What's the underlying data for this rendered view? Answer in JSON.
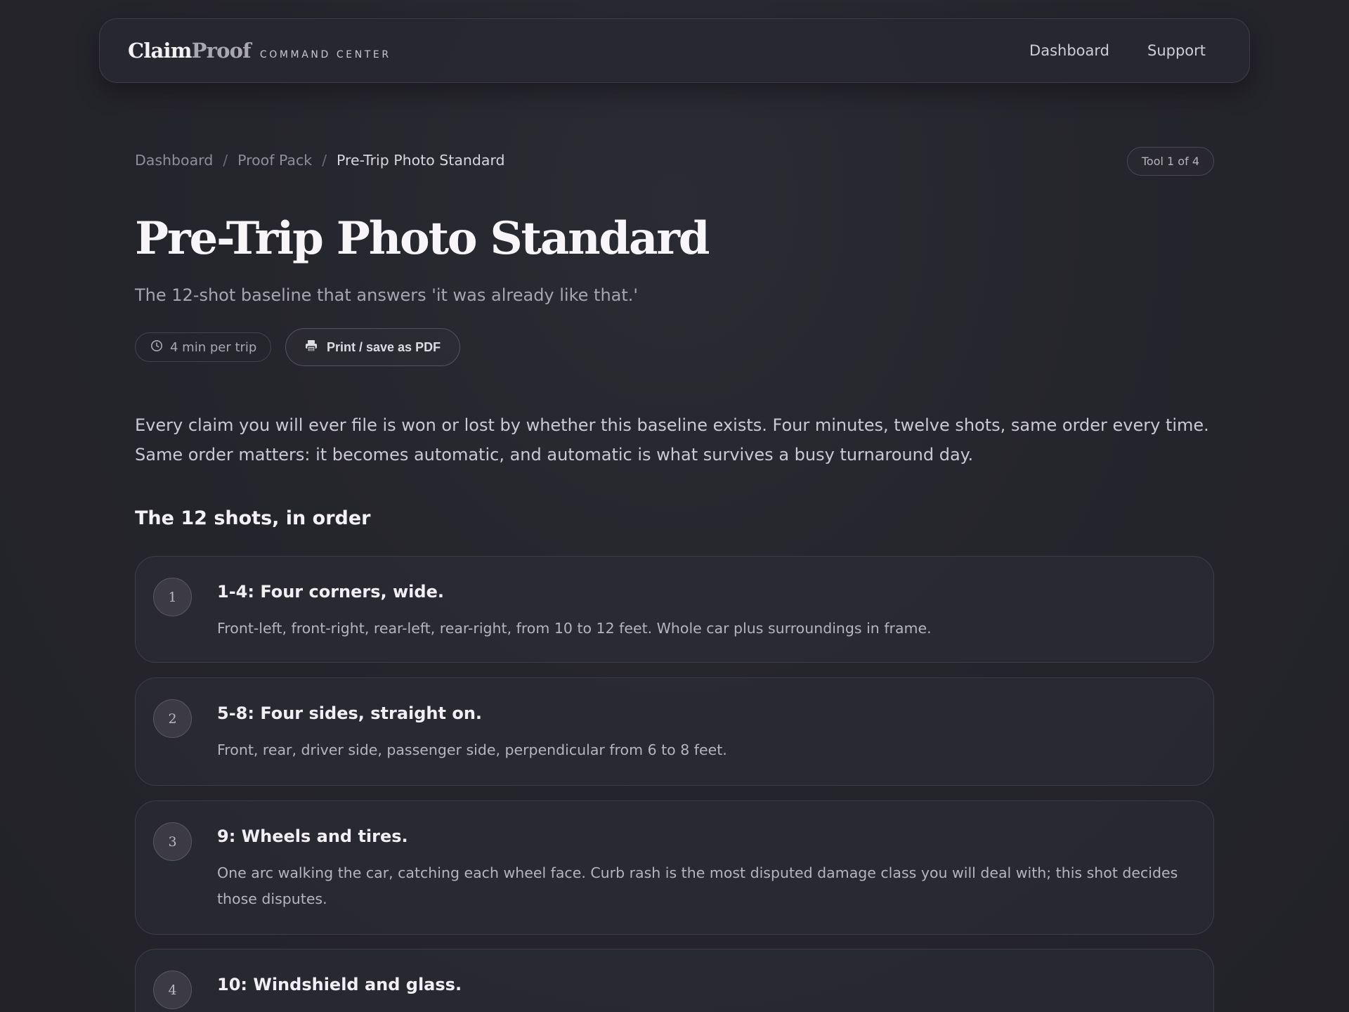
{
  "nav": {
    "brand_bold": "Claim",
    "brand_light": "Proof",
    "brand_sub": "COMMAND CENTER",
    "links": [
      "Dashboard",
      "Support"
    ]
  },
  "breadcrumb": {
    "items": [
      "Dashboard",
      "Proof Pack"
    ],
    "separator": "/",
    "current": "Pre-Trip Photo Standard"
  },
  "tool_badge": "Tool 1 of 4",
  "page": {
    "title": "Pre-Trip Photo Standard",
    "subtitle": "The 12-shot baseline that answers 'it was already like that.'",
    "time_chip": "4 min per trip",
    "print_button": "Print / save as PDF",
    "intro": "Every claim you will ever file is won or lost by whether this baseline exists. Four minutes, twelve shots, same order every time. Same order matters: it becomes automatic, and automatic is what survives a busy turnaround day."
  },
  "section_heading": "The 12 shots, in order",
  "shots": [
    {
      "num": "1",
      "title": "1-4: Four corners, wide.",
      "desc": "Front-left, front-right, rear-left, rear-right, from 10 to 12 feet. Whole car plus surroundings in frame."
    },
    {
      "num": "2",
      "title": "5-8: Four sides, straight on.",
      "desc": "Front, rear, driver side, passenger side, perpendicular from 6 to 8 feet."
    },
    {
      "num": "3",
      "title": "9: Wheels and tires.",
      "desc": "One arc walking the car, catching each wheel face. Curb rash is the most disputed damage class you will deal with; this shot decides those disputes."
    },
    {
      "num": "4",
      "title": "10: Windshield and glass.",
      "desc": ""
    }
  ],
  "icons": {
    "time_chip": "clock-icon",
    "print_button": "printer-icon"
  }
}
